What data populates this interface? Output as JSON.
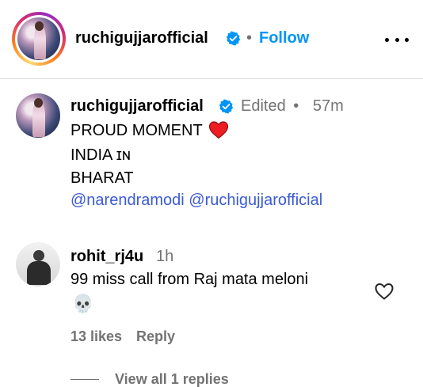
{
  "header": {
    "username": "ruchigujjarofficial",
    "separator": "•",
    "follow_label": "Follow"
  },
  "caption": {
    "username": "ruchigujjarofficial",
    "edited_label": "Edited",
    "separator": "•",
    "time": "57m",
    "line1": "PROUD MOMENT",
    "line2": "INDIA ɪɴ",
    "line3": "BHARAT",
    "mentions": [
      "@narendramodi",
      "@ruchigujjarofficial"
    ]
  },
  "reply": {
    "username": "rohit_rj4u",
    "time": "1h",
    "text": "99 miss call from Raj mata meloni",
    "emoji": "💀",
    "likes": "13 likes",
    "reply_label": "Reply",
    "view_replies": "View all 1 replies"
  },
  "colors": {
    "link": "#0095f6",
    "mention": "#3b5bd6",
    "muted": "#737373",
    "verified": "#0095f6",
    "heart_red": "#ed1d24"
  },
  "icons": {
    "verified": "verified-badge-icon",
    "heart": "red-heart-icon",
    "like": "heart-outline-icon",
    "more": "more-horizontal-icon"
  }
}
